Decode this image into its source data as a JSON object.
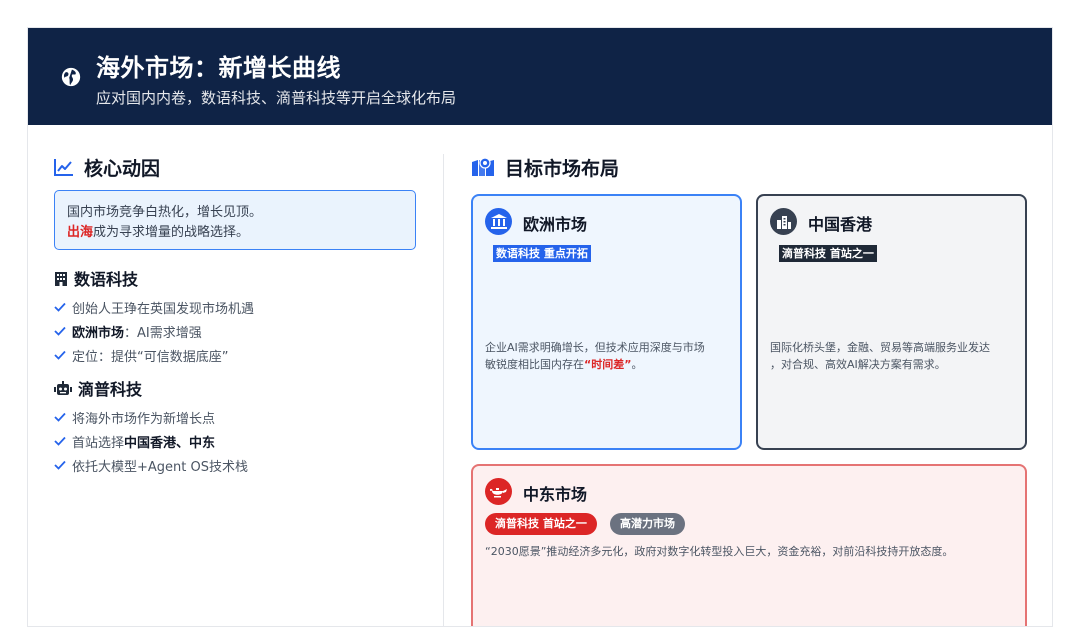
{
  "header": {
    "icon": "globe-icon",
    "title": "海外市场：新增长曲线",
    "subtitle": "应对国内内卷，数语科技、滴普科技等开启全球化布局"
  },
  "left": {
    "section_title": "核心动因",
    "section_icon": "trend-chart-icon",
    "callout": {
      "line1": "国内市场竞争白热化，增长见顶。",
      "line2_highlight": "出海",
      "line2_rest": "成为寻求增量的战略选择。"
    },
    "companies": [
      {
        "name": "数语科技",
        "icon": "building-icon",
        "items": [
          {
            "bold": "",
            "text": "创始人王琤在英国发现市场机遇"
          },
          {
            "bold": "欧洲市场",
            "text": "：AI需求增强"
          },
          {
            "bold": "",
            "text": "定位：提供“可信数据底座”"
          }
        ]
      },
      {
        "name": "滴普科技",
        "icon": "robot-icon",
        "items": [
          {
            "bold": "",
            "text": "将海外市场作为新增长点"
          },
          {
            "bold_pre": "首站选择",
            "bold": "中国香港、中东",
            "text": ""
          },
          {
            "bold": "",
            "text": "依托大模型+Agent OS技术栈"
          }
        ]
      }
    ]
  },
  "right": {
    "section_title": "目标市场布局",
    "section_icon": "map-icon",
    "markets": {
      "eu": {
        "name": "欧洲市场",
        "icon": "bank-icon",
        "tag": "数语科技 重点开拓",
        "desc_line1": "企业AI需求明确增长，但技术应用深度与市场",
        "desc_line2_pre": "敏锐度相比国内存在",
        "desc_line2_hl": "“时间差”",
        "desc_line2_post": "。"
      },
      "hk": {
        "name": "中国香港",
        "icon": "city-icon",
        "tag": "滴普科技 首站之一",
        "desc_line1": "国际化桥头堡，金融、贸易等高端服务业发达",
        "desc_line2": "，对合规、高效AI解决方案有需求。"
      },
      "me": {
        "name": "中东市场",
        "icon": "oil-lamp-icon",
        "pill1": "滴普科技 首站之一",
        "pill2": "高潜力市场",
        "desc": "“2030愿景”推动经济多元化，政府对数字化转型投入巨大，资金充裕，对前沿科技持开放态度。"
      }
    }
  },
  "colors": {
    "header_bg": "#0f2346",
    "accent_blue": "#2563eb",
    "accent_red": "#dc2626",
    "eu_border": "#3b82f6",
    "hk_border": "#374151",
    "me_border": "#e57373"
  }
}
